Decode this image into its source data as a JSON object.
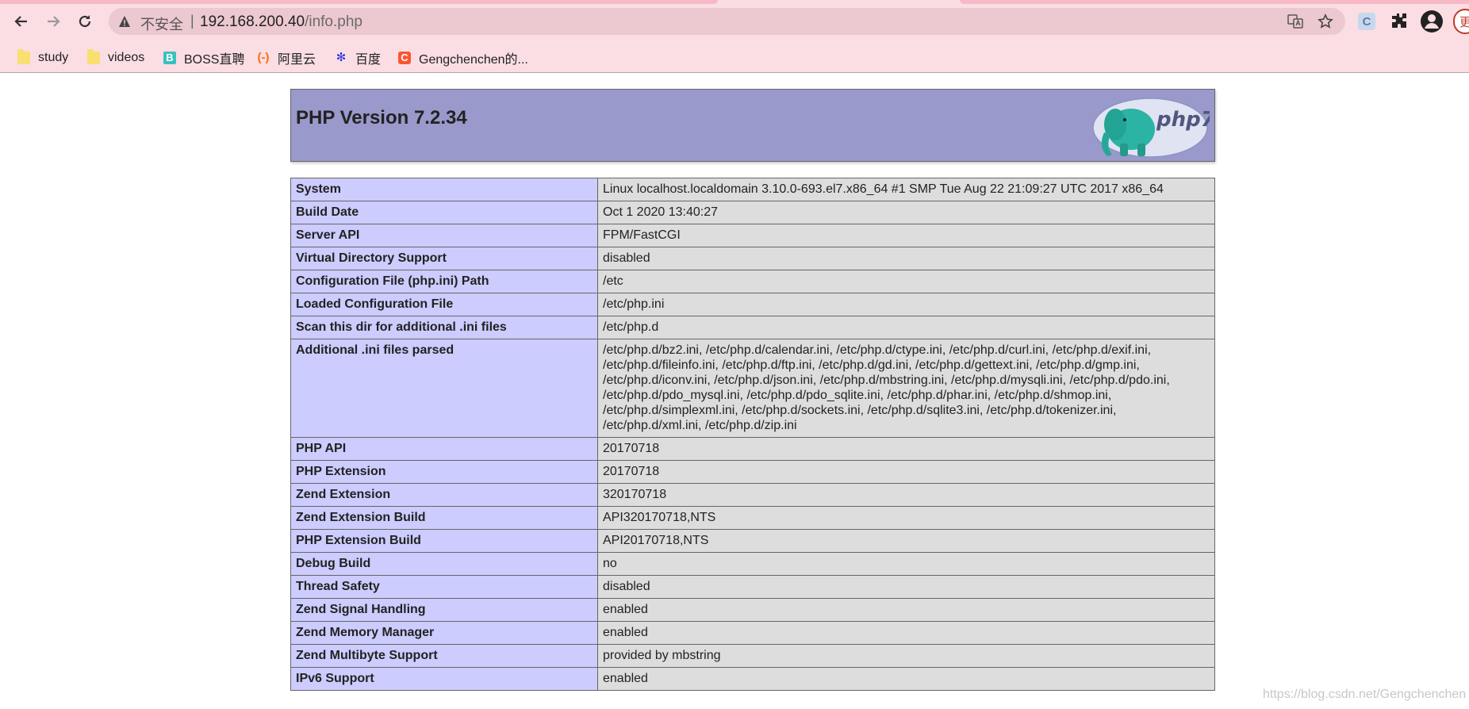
{
  "browser": {
    "security_label": "不安全",
    "separator": "|",
    "url_host": "192.168.200.40",
    "url_path": "/info.php",
    "extension_label": "C",
    "update_label": "更"
  },
  "bookmarks": [
    {
      "label": "study",
      "icon": "folder-icon"
    },
    {
      "label": "videos",
      "icon": "folder-icon"
    },
    {
      "label": "BOSS直聘",
      "icon": "boss-icon",
      "glyph": "B"
    },
    {
      "label": "阿里云",
      "icon": "aliyun-icon",
      "glyph": "(-)"
    },
    {
      "label": "百度",
      "icon": "baidu-icon",
      "glyph": "✻"
    },
    {
      "label": "Gengchenchen的...",
      "icon": "csdn-icon",
      "glyph": "C"
    }
  ],
  "php": {
    "title": "PHP Version 7.2.34",
    "logo_label": "php7",
    "rows": [
      {
        "key": "System",
        "value": "Linux localhost.localdomain 3.10.0-693.el7.x86_64 #1 SMP Tue Aug 22 21:09:27 UTC 2017 x86_64"
      },
      {
        "key": "Build Date",
        "value": "Oct 1 2020 13:40:27"
      },
      {
        "key": "Server API",
        "value": "FPM/FastCGI"
      },
      {
        "key": "Virtual Directory Support",
        "value": "disabled"
      },
      {
        "key": "Configuration File (php.ini) Path",
        "value": "/etc"
      },
      {
        "key": "Loaded Configuration File",
        "value": "/etc/php.ini"
      },
      {
        "key": "Scan this dir for additional .ini files",
        "value": "/etc/php.d"
      },
      {
        "key": "Additional .ini files parsed",
        "value": "/etc/php.d/bz2.ini, /etc/php.d/calendar.ini, /etc/php.d/ctype.ini, /etc/php.d/curl.ini, /etc/php.d/exif.ini, /etc/php.d/fileinfo.ini, /etc/php.d/ftp.ini, /etc/php.d/gd.ini, /etc/php.d/gettext.ini, /etc/php.d/gmp.ini, /etc/php.d/iconv.ini, /etc/php.d/json.ini, /etc/php.d/mbstring.ini, /etc/php.d/mysqli.ini, /etc/php.d/pdo.ini, /etc/php.d/pdo_mysql.ini, /etc/php.d/pdo_sqlite.ini, /etc/php.d/phar.ini, /etc/php.d/shmop.ini, /etc/php.d/simplexml.ini, /etc/php.d/sockets.ini, /etc/php.d/sqlite3.ini, /etc/php.d/tokenizer.ini, /etc/php.d/xml.ini, /etc/php.d/zip.ini"
      },
      {
        "key": "PHP API",
        "value": "20170718"
      },
      {
        "key": "PHP Extension",
        "value": "20170718"
      },
      {
        "key": "Zend Extension",
        "value": "320170718"
      },
      {
        "key": "Zend Extension Build",
        "value": "API320170718,NTS"
      },
      {
        "key": "PHP Extension Build",
        "value": "API20170718,NTS"
      },
      {
        "key": "Debug Build",
        "value": "no"
      },
      {
        "key": "Thread Safety",
        "value": "disabled"
      },
      {
        "key": "Zend Signal Handling",
        "value": "enabled"
      },
      {
        "key": "Zend Memory Manager",
        "value": "enabled"
      },
      {
        "key": "Zend Multibyte Support",
        "value": "provided by mbstring"
      },
      {
        "key": "IPv6 Support",
        "value": "enabled"
      }
    ]
  },
  "watermark": "https://blog.csdn.net/Gengchenchen",
  "colors": {
    "chrome_bg": "#fbdde4",
    "header_bg": "#9999cc",
    "key_cell_bg": "#ccccff",
    "value_cell_bg": "#dddddd"
  }
}
